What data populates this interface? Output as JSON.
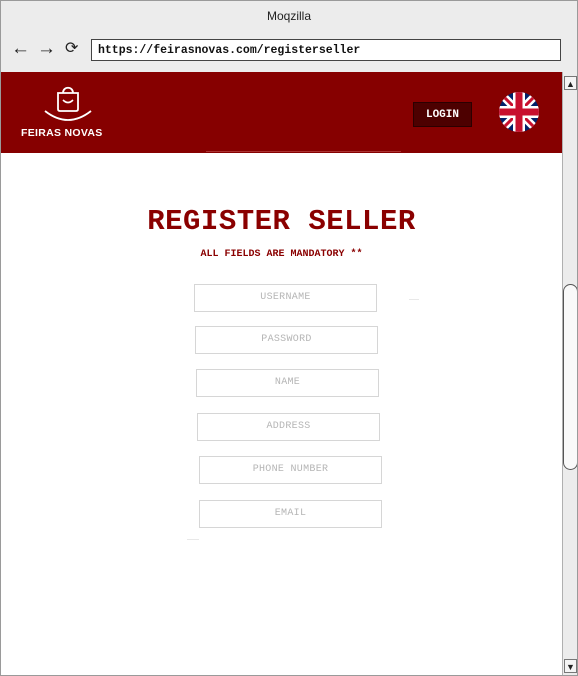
{
  "browser": {
    "window_title": "Moqzilla",
    "back_icon": "←",
    "forward_icon": "→",
    "reload_icon": "⟳",
    "url": "https://feirasnovas.com/registerseller"
  },
  "header": {
    "logo_text": "FEIRAS NOVAS",
    "login_label": "LOGIN",
    "language_flag": "uk-flag",
    "background_color": "#860000"
  },
  "form": {
    "title": "REGISTER SELLER",
    "subtitle": "ALL FIELDS ARE MANDATORY **",
    "fields": {
      "username": "USERNAME",
      "password": "PASSWORD",
      "name": "NAME",
      "address": "ADDRESS",
      "phone": "PHONE NUMBER",
      "email": "EMAIL"
    }
  },
  "scrollbar": {
    "up_icon": "▲",
    "down_icon": "▼"
  }
}
